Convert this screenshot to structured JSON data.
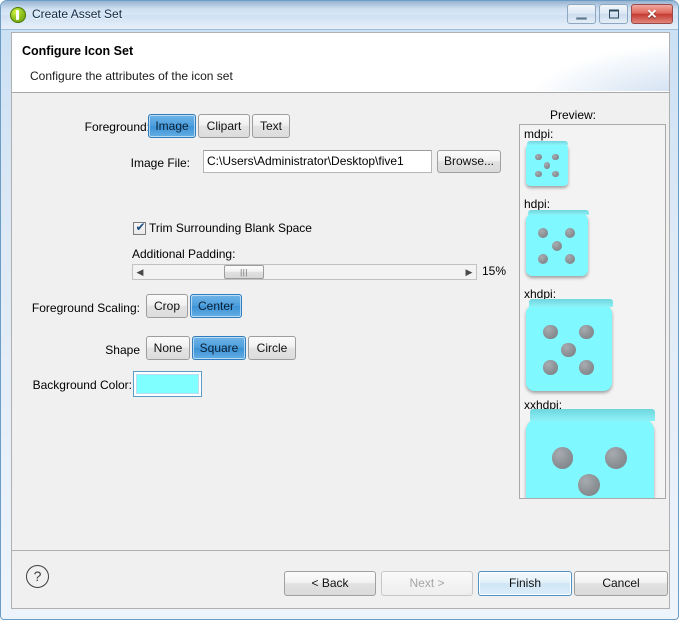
{
  "window": {
    "title": "Create Asset Set",
    "app_icon": "android-asset-studio-icon",
    "controls": {
      "minimize": "minimize-icon",
      "maximize": "maximize-icon",
      "close": "✕"
    }
  },
  "header": {
    "title": "Configure Icon Set",
    "subtitle": "Configure the attributes of the icon set"
  },
  "form": {
    "foreground": {
      "label": "Foreground:",
      "options": [
        {
          "label": "Image",
          "selected": true
        },
        {
          "label": "Clipart",
          "selected": false
        },
        {
          "label": "Text",
          "selected": false
        }
      ]
    },
    "image_file": {
      "label": "Image File:",
      "value": "C:\\Users\\Administrator\\Desktop\\five1",
      "placeholder": "",
      "browse_label": "Browse..."
    },
    "trim": {
      "label": "Trim Surrounding Blank Space",
      "checked": true,
      "check_glyph": "✔"
    },
    "padding": {
      "label": "Additional Padding:",
      "value_text": "15%",
      "value": 15,
      "thumb_position_pct": 28,
      "arrow_left": "◀",
      "arrow_right": "▶",
      "grip": "|||"
    },
    "foreground_scaling": {
      "label": "Foreground Scaling:",
      "options": [
        {
          "label": "Crop",
          "selected": false
        },
        {
          "label": "Center",
          "selected": true
        }
      ]
    },
    "shape": {
      "label": "Shape",
      "options": [
        {
          "label": "None",
          "selected": false
        },
        {
          "label": "Square",
          "selected": true
        },
        {
          "label": "Circle",
          "selected": false
        }
      ]
    },
    "background_color": {
      "label": "Background Color:",
      "value": "#7FFFFF"
    }
  },
  "preview": {
    "label": "Preview:",
    "items": [
      {
        "label": "mdpi:",
        "icon": "dice-five-icon",
        "size": 42
      },
      {
        "label": "hdpi:",
        "icon": "dice-five-icon",
        "size": 64
      },
      {
        "label": "xhdpi:",
        "icon": "dice-five-icon",
        "size": 86
      },
      {
        "label": "xxhdpi:",
        "icon": "dice-five-icon",
        "size": 128
      }
    ],
    "icon_colors": {
      "face": "#7FF9FF",
      "frame": "#7A7F85",
      "pip": "#8B9094"
    }
  },
  "footer": {
    "help": "?",
    "buttons": [
      {
        "label": "< Back",
        "state": "enabled"
      },
      {
        "label": "Next >",
        "state": "disabled"
      },
      {
        "label": "Finish",
        "state": "default"
      },
      {
        "label": "Cancel",
        "state": "enabled"
      }
    ]
  }
}
